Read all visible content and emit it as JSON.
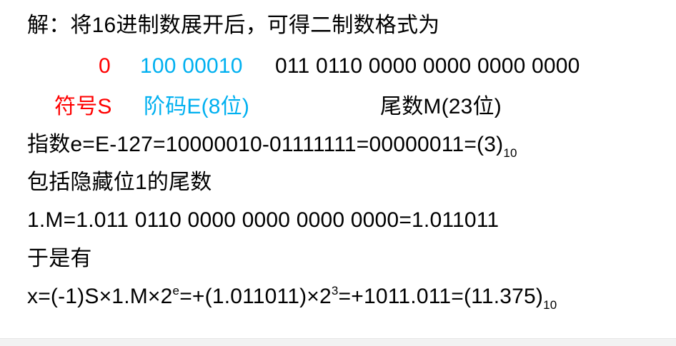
{
  "solution": {
    "line1": "解：将16进制数展开后，可得二制数格式为",
    "binary": {
      "sign": "0",
      "exponent": "100 00010",
      "mantissa": "011 0110 0000 0000 0000 0000"
    },
    "labels": {
      "sign": "符号S",
      "exponent": "阶码E(8位)",
      "mantissa": "尾数M(23位)"
    },
    "exponent_calc": {
      "text": "指数e=E-127=10000010-01111111=00000011=(3)",
      "base": "10"
    },
    "hidden_bit_text": "包括隐藏位1的尾数",
    "mantissa_value": "1.M=1.011 0110 0000 0000 0000 0000=1.011011",
    "therefore": "于是有",
    "final": {
      "part1": "x=(-1)S×1.M×2",
      "exp_e": "e",
      "part2": "=+(1.011011)×2",
      "exp_3": "3",
      "part3": "=+1011.011=(11.375)",
      "base": "10"
    }
  },
  "colors": {
    "sign": "#ff0000",
    "exponent": "#00b0f0",
    "text": "#000000"
  }
}
